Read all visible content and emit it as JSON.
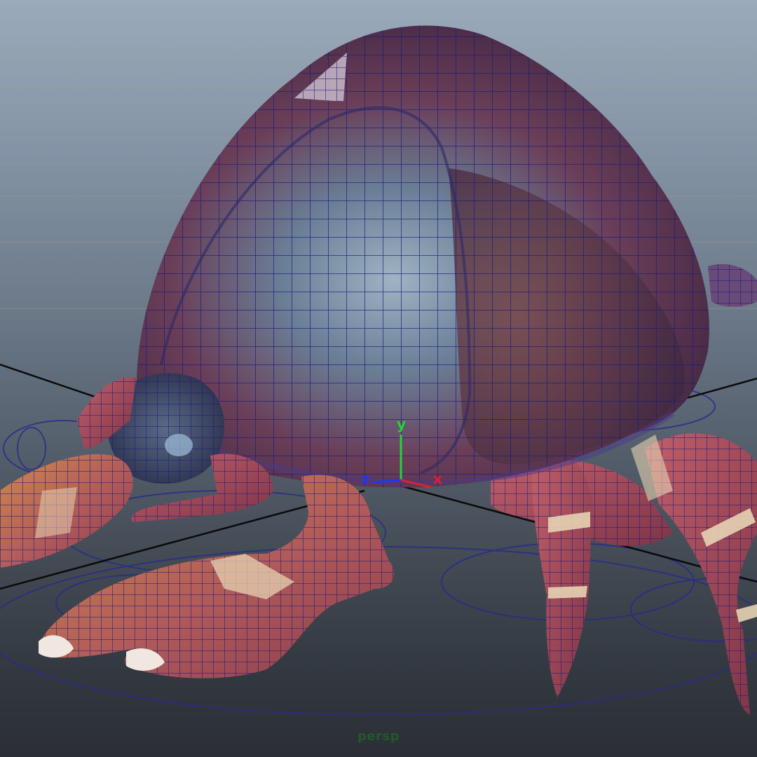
{
  "viewport": {
    "camera_label": "persp"
  },
  "view_axis": {
    "x_label": "x",
    "y_label": "y",
    "z_label": "z",
    "x_color": "#e0202a",
    "y_color": "#22d43a",
    "z_color": "#2233ff"
  },
  "model": {
    "shell_color": "#6b3a52",
    "leg_color": "#a84a5c",
    "band_color": "#e6d3b2",
    "wireframe_color": "#1a1a7a"
  },
  "background": {
    "top_color": "#9aaabb",
    "bottom_color": "#2b2f35"
  }
}
